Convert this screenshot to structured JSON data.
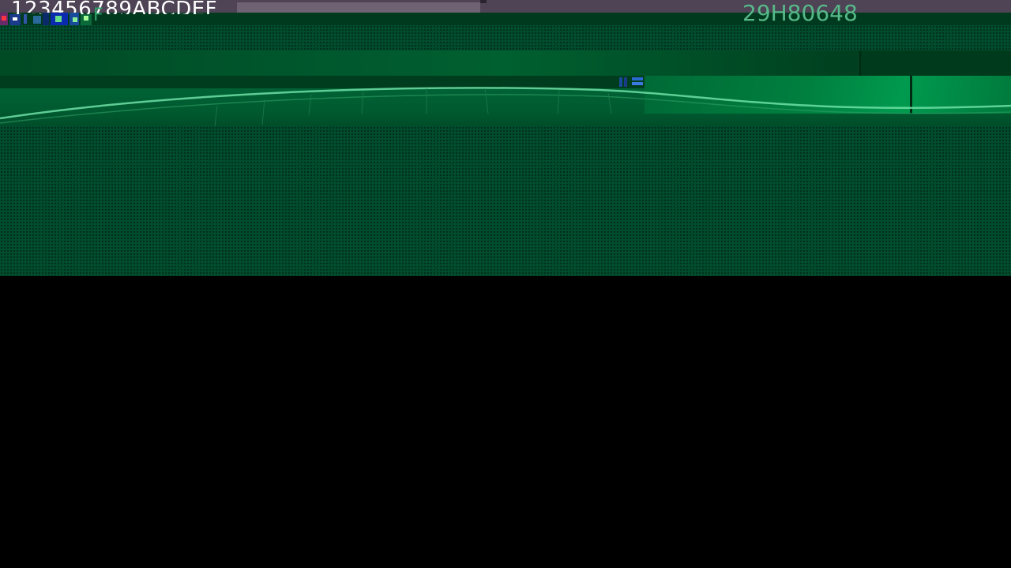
{
  "header": {
    "hex_string": "123456789ABCDEF",
    "hex_id": "29H80648",
    "glitch_label": "F"
  },
  "colors": {
    "top_bar": "#4e4455",
    "panel_green": "#004d2e",
    "accent_text": "#57b989",
    "background": "#000000"
  },
  "icons": {
    "glitch_cluster": "corrupted-icon-strip",
    "glitch_mid": "corrupted-mark"
  }
}
